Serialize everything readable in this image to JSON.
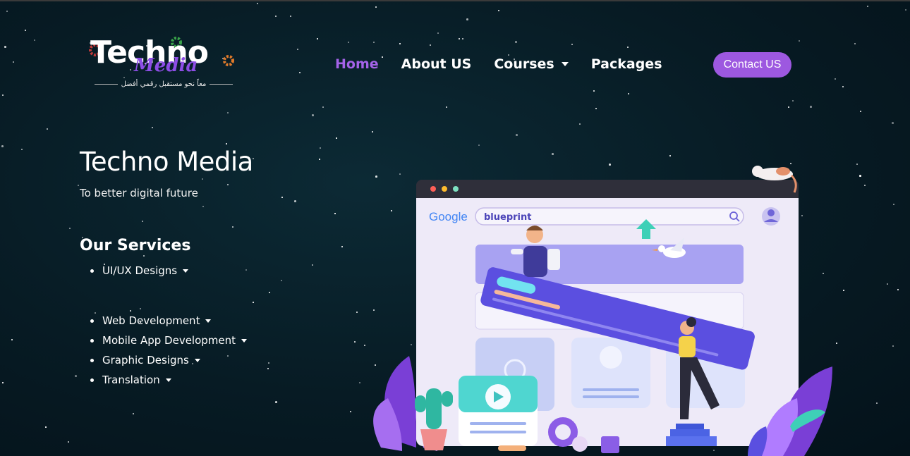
{
  "brand": {
    "logo_line1": "Techno",
    "logo_line2": "Media",
    "logo_tagline": "معاً نحو مستقبل رقمي أفضل"
  },
  "nav": {
    "items": [
      {
        "label": "Home",
        "active": true,
        "dropdown": false
      },
      {
        "label": "About US",
        "active": false,
        "dropdown": false
      },
      {
        "label": "Courses",
        "active": false,
        "dropdown": true
      },
      {
        "label": "Packages",
        "active": false,
        "dropdown": false
      }
    ],
    "contact_label": "Contact US"
  },
  "hero": {
    "title": "Techno Media",
    "subtitle": "To better digital future"
  },
  "services": {
    "heading": "Our Services",
    "items": [
      "UI/UX Designs",
      "Web Development",
      "Mobile App Development",
      "Graphic Designs",
      "Translation"
    ]
  },
  "illustration": {
    "search_brand": "Google",
    "search_query": "blueprint"
  },
  "colors": {
    "accent": "#9d58e0",
    "active_nav": "#a463e8",
    "background": "#071b24"
  }
}
